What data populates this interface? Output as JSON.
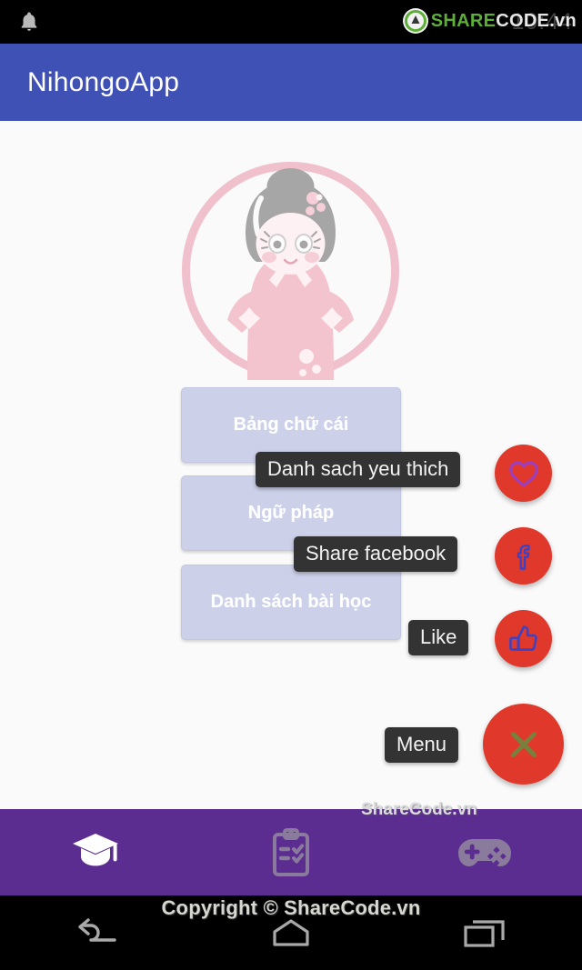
{
  "status_bar": {
    "bell_icon": "notification-bell-icon",
    "clock": "10:44",
    "watermark_share": "SHARE",
    "watermark_code": "CODE.vn"
  },
  "app_bar": {
    "title": "NihongoApp"
  },
  "content": {
    "avatar_alt": "japanese-kokeshi-doll-avatar",
    "menu_buttons": [
      {
        "label": "Bảng chữ cái",
        "name": "alphabet"
      },
      {
        "label": "Ngữ pháp",
        "name": "grammar"
      },
      {
        "label": "Danh sách bài học",
        "name": "lessons"
      }
    ],
    "fab_menu": [
      {
        "label": "Danh sach yeu thich",
        "icon": "heart-icon",
        "name": "favorite"
      },
      {
        "label": "Share facebook",
        "icon": "facebook-icon",
        "name": "share"
      },
      {
        "label": "Like",
        "icon": "thumbs-up-icon",
        "name": "like"
      },
      {
        "label": "Menu",
        "icon": "close-x-icon",
        "name": "menu"
      }
    ],
    "watermark": "ShareCode.vn"
  },
  "bottom_nav": {
    "items": [
      {
        "icon": "graduation-cap-icon",
        "name": "learn",
        "active": true
      },
      {
        "icon": "clipboard-checklist-icon",
        "name": "test",
        "active": false
      },
      {
        "icon": "gamepad-icon",
        "name": "game",
        "active": false
      }
    ],
    "watermark": "ShareCode.vn"
  },
  "android_nav": {
    "back": "back-icon",
    "home": "home-icon",
    "recents": "recents-icon",
    "copyright": "Copyright © ShareCode.vn"
  },
  "colors": {
    "app_bar": "#3f51b5",
    "fab": "#e0392b",
    "bottom_nav": "#5b2d90",
    "menu_button": "#ccd0e8",
    "tooltip": "#333333",
    "brand_green": "#62b83a"
  }
}
